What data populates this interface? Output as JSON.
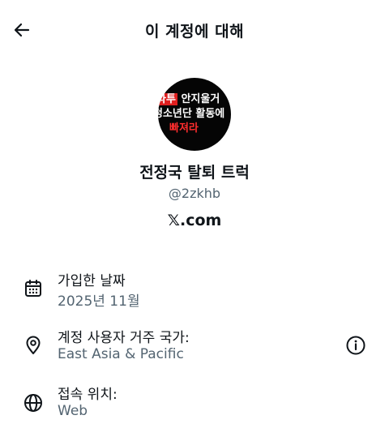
{
  "header": {
    "title": "이 계정에 대해"
  },
  "profile": {
    "avatar_lines": [
      "타투 안지울거",
      "청소년단 활동에",
      "빠져라"
    ],
    "display_name": "전정국 탈퇴 트럭",
    "handle": "@2zkhb",
    "platform": "𝕏.com"
  },
  "details": [
    {
      "icon": "calendar-icon",
      "label": "가입한 날짜",
      "value": "2025년 11월"
    },
    {
      "icon": "location-pin-icon",
      "label": "계정 사용자 거주 국가:",
      "value": "East Asia & Pacific"
    },
    {
      "icon": "globe-icon",
      "label": "접속 위치:",
      "value": "Web"
    }
  ],
  "colors": {
    "text_primary": "#0f1419",
    "text_secondary": "#536471",
    "avatar_bg": "#050505",
    "avatar_red": "#e01f1f"
  }
}
